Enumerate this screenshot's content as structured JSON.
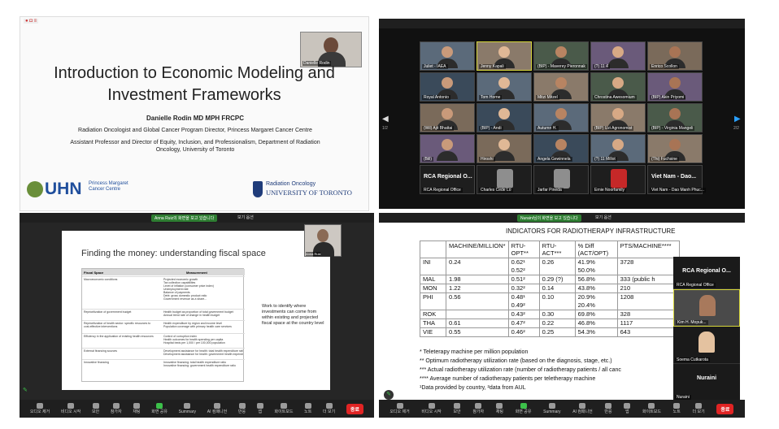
{
  "q1": {
    "flag_text": "● ◘ ≡",
    "title": "Introduction to Economic Modeling and Investment Frameworks",
    "author": "Danielle Rodin MD MPH FRCPC",
    "aff1": "Radiation Oncologist and Global Cancer Program Director, Princess Margaret Cancer Centre",
    "aff2": "Assistant Professor and Director of Equity, Inclusion, and Professionalism, Department of Radiation Oncology, University of Toronto",
    "uhn_logo": "UHN",
    "uhn_sub": "Princess Margaret Cancer Centre",
    "uoft_top": "Radiation Oncology",
    "uoft_main": "UNIVERSITY OF TORONTO",
    "presenter_label": "Danielle Rodin"
  },
  "q2": {
    "tiles": [
      {
        "name": "Juliet - IAEA"
      },
      {
        "name": "Jenny Kapali"
      },
      {
        "name": "(BIP) - Maverey Pieronnak"
      },
      {
        "name": "(?) 11 4̇̇"
      },
      {
        "name": "Enrico Scollon"
      },
      {
        "name": "Royal Antonio"
      },
      {
        "name": "Tom Horne"
      },
      {
        "name": "Mitzi Mitzel"
      },
      {
        "name": "Chrostina Awesomium"
      },
      {
        "name": "(BIP) Akin Priyomi"
      },
      {
        "name": "(Wil) Ajit Bhattai"
      },
      {
        "name": "(BIP) - Andi"
      },
      {
        "name": "Autumn H."
      },
      {
        "name": "(BIP) Uzi Agronomist"
      },
      {
        "name": "(BIP) - Virginia Mangeli"
      },
      {
        "name": "(Bill)"
      },
      {
        "name": "Hiroshi"
      },
      {
        "name": "Angela Gewinnela"
      },
      {
        "name": "(?) 11 Millot"
      },
      {
        "name": "(Thi) Fuchsine"
      }
    ],
    "bottom_tiles": [
      {
        "big": "RCA Regional O...",
        "name": "RCA Regional Office"
      },
      {
        "big": "",
        "name": "Charles Cede Lo"
      },
      {
        "big": "",
        "name": "Jarfar Pineda"
      },
      {
        "big": "",
        "name": "Ernie Noorfamily"
      },
      {
        "big": "Viet Nam - Dao...",
        "name": "Viet Nam - Dao Manh Phuc..."
      }
    ],
    "page_left": "1/2",
    "page_right": "2/2"
  },
  "q3": {
    "pill": "Anna Ruiz의 화면을 보고 있습니다",
    "options": "보기 옵션",
    "slide_title": "Finding the money: understanding fiscal space",
    "col1": "Fiscal Space",
    "col2": "Measurement",
    "side_text": "Work to identify where investments can come from within existing and projected fiscal space at the country level",
    "presenter": "Anna Ruiz",
    "rows": [
      {
        "label": "Macroeconomic conditions",
        "items": [
          "Projected economic growth",
          "Tax collection capabilities",
          "Level of inflation (consumer price index)",
          "Unemployment rate",
          "Balance of payments",
          "Debt: gross domestic product ratio",
          "Government revenue as a share..."
        ]
      },
      {
        "label": "Reprioritization of government budget",
        "items": [
          "Health budget as proportion of total government budget",
          "Annual trend rate of change in health budget"
        ]
      },
      {
        "label": "Reprioritization of health sector: specific resources to cost-effective interventions",
        "items": [
          "Health expenditure by region and income level",
          "Population coverage with primary health care services"
        ]
      },
      {
        "label": "Efficiency in the application of existing health resources",
        "items": [
          "Control of corruption index",
          "Health outcomes for health spending per capita",
          "Hospital beds per 1,000 / per 100,000 population"
        ]
      },
      {
        "label": "External financing sources",
        "items": [
          "Development assistance for health: total health expenditure ratio",
          "Development assistance for health: government health expenditure ratio"
        ]
      },
      {
        "label": "Innovative financing",
        "items": [
          "Innovative financing: total health expenditure ratio",
          "Innovative financing: government health expenditure ratio"
        ]
      }
    ]
  },
  "q4": {
    "pill": "Nuraini님의 화면을 보고 있습니다",
    "options": "보기 옵션",
    "title": "INDICATORS FOR RADIOTHERAPY INFRASTRUCTURE",
    "headers": [
      "",
      "MACHINE/MILLION*",
      "RTU-OPT**",
      "RTU-ACT***",
      "% Diff (ACT/OPT)",
      "PTS/MACHINE****"
    ],
    "rows": [
      [
        "INI",
        "0.24",
        "0.62¹\n0.52²",
        "0.26",
        "41.9%\n50.0%",
        "3728"
      ],
      [
        "MAL",
        "1.98",
        "0.51²",
        "0.29 (?)",
        "56.8%",
        "333 (public h"
      ],
      [
        "MON",
        "1.22",
        "0.32²",
        "0.14",
        "43.8%",
        "210"
      ],
      [
        "PHI",
        "0.56",
        "0.48¹\n0.49²",
        "0.10",
        "20.9%\n20.4%",
        "1208"
      ],
      [
        "ROK",
        "",
        "0.43²",
        "0.30",
        "69.8%",
        "328"
      ],
      [
        "THA",
        "0.61",
        "0.47²",
        "0.22",
        "46.8%",
        "1117"
      ],
      [
        "VIE",
        "0.55",
        "0.46²",
        "0.25",
        "54.3%",
        "643"
      ]
    ],
    "notes": [
      "*  Teleterapy machine per million population",
      "** Optimum radiotherapy utilization rate (based on the diagnosis, stage, etc.)",
      "*** Actual radiotherapy utilization rate (number of radiotherapy patients / all canc",
      "**** Average number of radiotherapy patients per teletherapy machine",
      "¹Data provided by country, ²data from AUL"
    ],
    "side": [
      {
        "big": "RCA Regional O...",
        "name": "RCA Regional Office"
      },
      {
        "big": "",
        "name": "Kim H. Mopuk..."
      },
      {
        "big": "",
        "name": "Soema Cutkarota"
      },
      {
        "big": "Nuraini",
        "name": "Nuraini"
      }
    ]
  },
  "toolbar": {
    "items": [
      "오디오 제거",
      "비디오 시작",
      "보안",
      "참가자",
      "채팅",
      "화면 공유",
      "Summary",
      "AI 컴패니언",
      "반응",
      "앱",
      "화이트보드",
      "노트",
      "더 보기"
    ],
    "end": "종료",
    "participants": "36"
  }
}
